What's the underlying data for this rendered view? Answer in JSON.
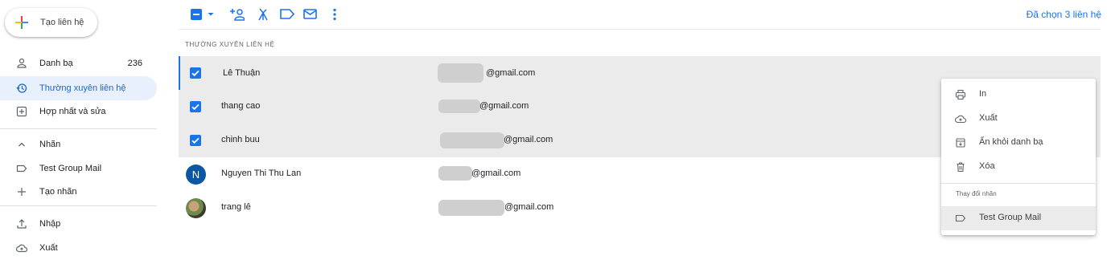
{
  "sidebar": {
    "create_label": "Tạo liên hệ",
    "items": [
      {
        "label": "Danh bạ",
        "count": "236"
      },
      {
        "label": "Thường xuyên liên hệ"
      },
      {
        "label": "Hợp nhất và sửa"
      },
      {
        "label": "Nhãn"
      },
      {
        "label": "Test Group Mail"
      },
      {
        "label": "Tạo nhãn"
      },
      {
        "label": "Nhập"
      },
      {
        "label": "Xuất"
      }
    ]
  },
  "toolbar": {
    "selected_text": "Đã chọn 3 liên hệ"
  },
  "section_title": "THƯỜNG XUYÊN LIÊN HỆ",
  "contacts": [
    {
      "name": "Lê Thuận",
      "email_domain": "@gmail.com",
      "selected": true
    },
    {
      "name": "thang cao",
      "email_domain": "@gmail.com",
      "selected": true
    },
    {
      "name": "chinh buu",
      "email_domain": "@gmail.com",
      "selected": true
    },
    {
      "name": "Nguyen Thi Thu Lan",
      "email_domain": "@gmail.com",
      "selected": false,
      "avatar_letter": "N"
    },
    {
      "name": "trang lê",
      "email_domain": "@gmail.com",
      "selected": false
    }
  ],
  "menu": {
    "items": [
      {
        "label": "In",
        "icon": "print-icon"
      },
      {
        "label": "Xuất",
        "icon": "cloud-upload-icon"
      },
      {
        "label": "Ẩn khỏi danh bạ",
        "icon": "archive-icon"
      },
      {
        "label": "Xóa",
        "icon": "trash-icon"
      }
    ],
    "subheading": "Thay đổi nhãn",
    "label_item": "Test Group Mail"
  },
  "colors": {
    "accent": "#1a73e8",
    "active_bg": "#e8f0fe",
    "selected_row_bg": "#ebebeb"
  }
}
